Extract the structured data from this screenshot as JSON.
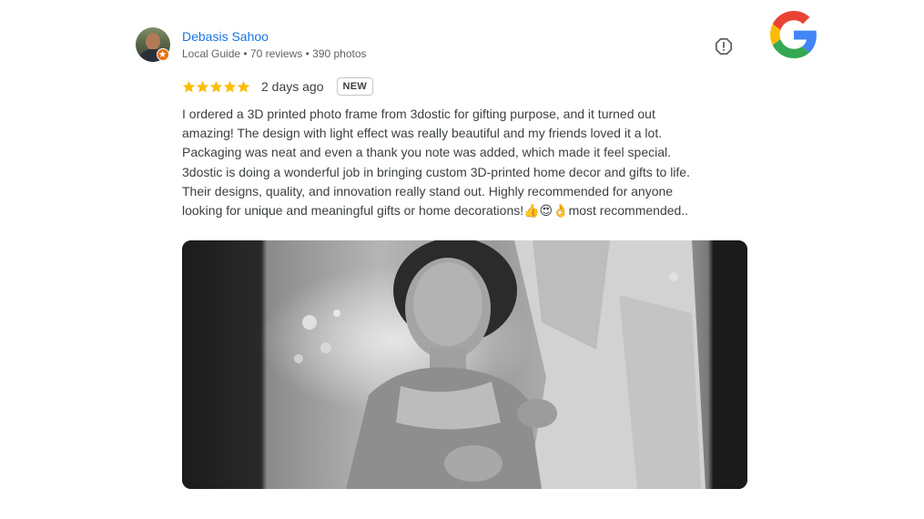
{
  "reviewer": {
    "name": "Debasis Sahoo",
    "meta": "Local Guide • 70 reviews • 390 photos",
    "avatar_icon": "reviewer-avatar",
    "badge_icon": "local-guide-star-icon"
  },
  "rating": {
    "stars": 5,
    "star_color": "#fbbc04",
    "date": "2 days ago",
    "badge": "NEW"
  },
  "review": {
    "lines": [
      "I ordered a 3D printed photo frame from 3dostic for gifting purpose, and it turned out",
      "amazing! The design with light effect was really beautiful and my friends loved it a lot.",
      "Packaging was neat and even a thank you note was added, which made it feel special.",
      "3dostic is doing a wonderful job in bringing custom 3D-printed home decor and gifts to life.",
      "Their designs, quality, and innovation really stand out. Highly recommended for anyone",
      "looking for unique and meaningful gifts or home decorations!👍😍👌most recommended.."
    ]
  },
  "icons": {
    "report": "report-flag-icon",
    "google": "google-logo-icon"
  },
  "colors": {
    "name_link": "#1a73e8",
    "secondary_text": "#5f6368",
    "body_text": "#3c4043",
    "local_guide_badge": "#e8710a"
  },
  "photo": {
    "subject": "review-photo"
  }
}
